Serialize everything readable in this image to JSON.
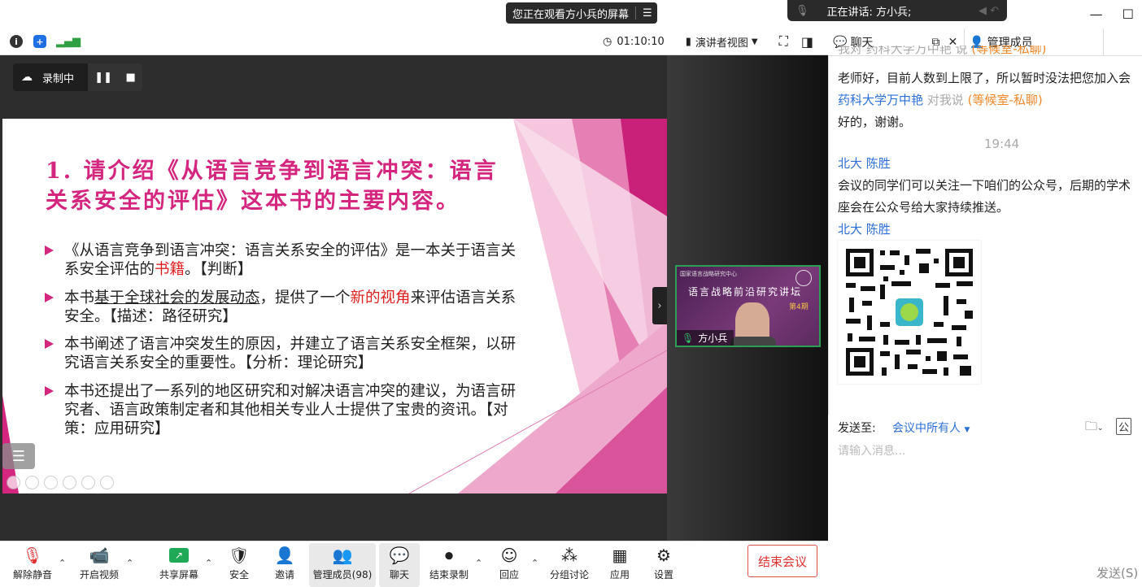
{
  "banner": {
    "viewing": "您正在观看方小兵的屏幕",
    "speaking": "正在讲话:  方小兵;"
  },
  "infobar": {
    "timer": "01:10:10",
    "view_mode": "演讲者视图"
  },
  "recording": {
    "label": "录制中"
  },
  "slide": {
    "title": "1. 请介绍《从语言竞争到语言冲突：语言关系安全的评估》这本书的主要内容。",
    "bullets": [
      {
        "parts": [
          "《从语言竞争到语言冲突：语言关系安全的评估》是一本关于语言关系安全评估的",
          "书籍",
          "。【判断】"
        ]
      },
      {
        "parts": [
          "本书",
          "基于全球社会的发展动态",
          "，提供了一个",
          "新的视角",
          "来评估语言关系安全。【描述：路径研究】"
        ]
      },
      {
        "parts": [
          "本书阐述了语言冲突发生的原因，并建立了语言关系安全框架，以研究语言关系安全的重要性。【分析：理论研究】"
        ]
      },
      {
        "parts": [
          "本书还提出了一系列的地区研究和对解决语言冲突的建议，为语言研究者、语言政策制定者和其他相关专业人士提供了宝贵的资讯。【对策：应用研究】"
        ]
      }
    ]
  },
  "thumbnail": {
    "banner": "语言战略前沿研究讲坛",
    "header": "国家语言战略研究中心",
    "issue": "第4期",
    "name": "方小兵"
  },
  "toolbar": {
    "mute": "解除静音",
    "video": "开启视频",
    "share": "共享屏幕",
    "security": "安全",
    "invite": "邀请",
    "participants": "管理成员(98)",
    "chat": "聊天",
    "stop_rec": "结束录制",
    "reactions": "回应",
    "breakout": "分组讨论",
    "apps": "应用",
    "settings": "设置",
    "end": "结束会议"
  },
  "chat": {
    "tab_chat": "聊天",
    "tab_members": "管理成员",
    "messages": [
      {
        "sender": "我对 药科大学万中艳 说",
        "tag": "(等候室-私聊)",
        "text": "老师好，目前人数到上限了，所以暂时没法把您加入会"
      },
      {
        "sender": "药科大学万中艳",
        "to": "对我说",
        "tag": "(等候室-私聊)",
        "text": "好的，谢谢。"
      },
      {
        "time": "19:44"
      },
      {
        "sender": "北大 陈胜",
        "text1": "会议的同学们可以关注一下咱们的公众号，后期的学术",
        "text2": "座会在公众号给大家持续推送。"
      },
      {
        "sender": "北大 陈胜"
      }
    ],
    "send_to_label": "发送至:",
    "send_to_value": "会议中所有人",
    "placeholder": "请输入消息...",
    "send_label": "发送(S)"
  },
  "colors": {
    "accent": "#d4267f",
    "link": "#2b6fd6",
    "tag": "#f0882a",
    "end": "#e03030"
  }
}
